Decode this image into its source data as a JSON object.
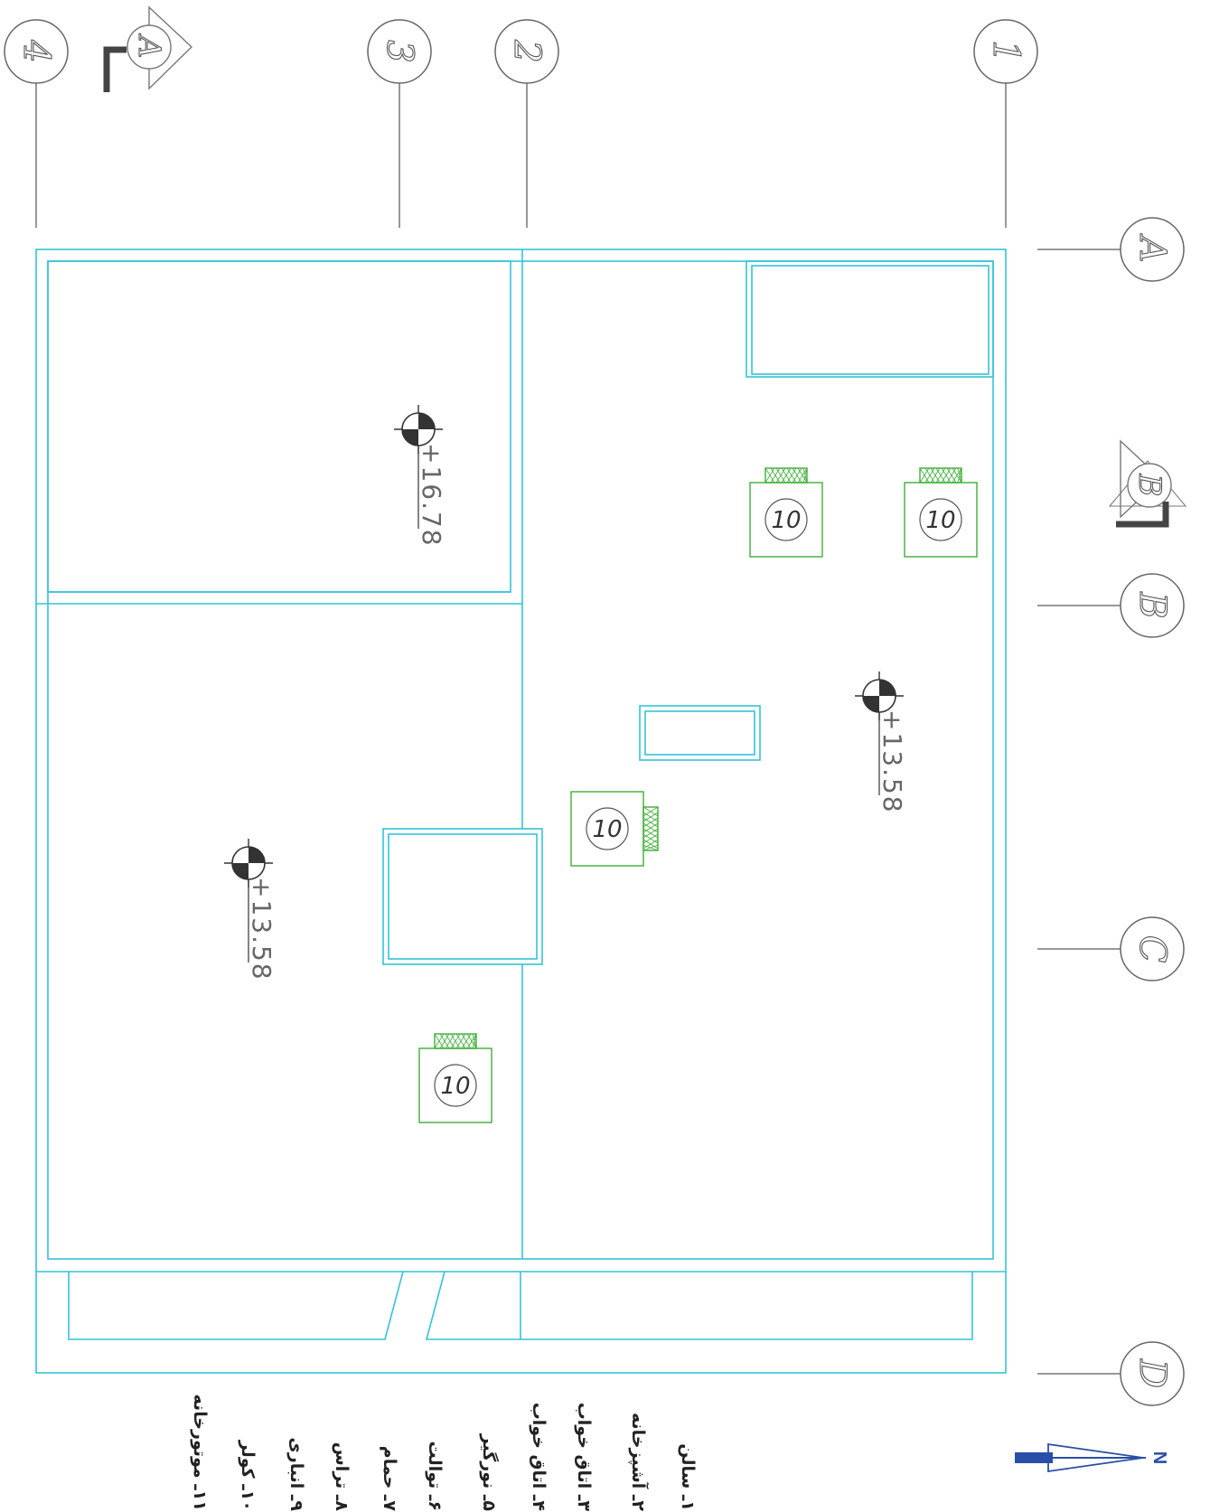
{
  "axes": {
    "columns": [
      {
        "label": "4"
      },
      {
        "label": "3"
      },
      {
        "label": "2"
      },
      {
        "label": "1"
      }
    ],
    "rows": [
      {
        "label": "A"
      },
      {
        "label": "B"
      },
      {
        "label": "C"
      },
      {
        "label": "D"
      }
    ]
  },
  "section_markers": [
    {
      "label": "A"
    },
    {
      "label": "B"
    }
  ],
  "elevations": [
    {
      "value": "+16.78"
    },
    {
      "value": "+13.58"
    },
    {
      "value": "+13.58"
    }
  ],
  "unit_tag": "10",
  "legend": [
    "۱ـ سالن",
    "۲ـ آشپزخانه",
    "۳ـ اتاق خواب",
    "۴ـ اتاق خواب",
    "۵ـ نورگیر",
    "۶ـ توالت",
    "۷ـ حمام",
    "۸ـ تراس",
    "۹ـ انباری",
    "۱۰ـ کولر",
    "۱۱ـ موتورخانه"
  ],
  "north_label": "N",
  "colors": {
    "walls": "#35c3d6",
    "equipment": "#3fae37",
    "grid": "#777777",
    "north_arrow": "#2a4fa8"
  }
}
